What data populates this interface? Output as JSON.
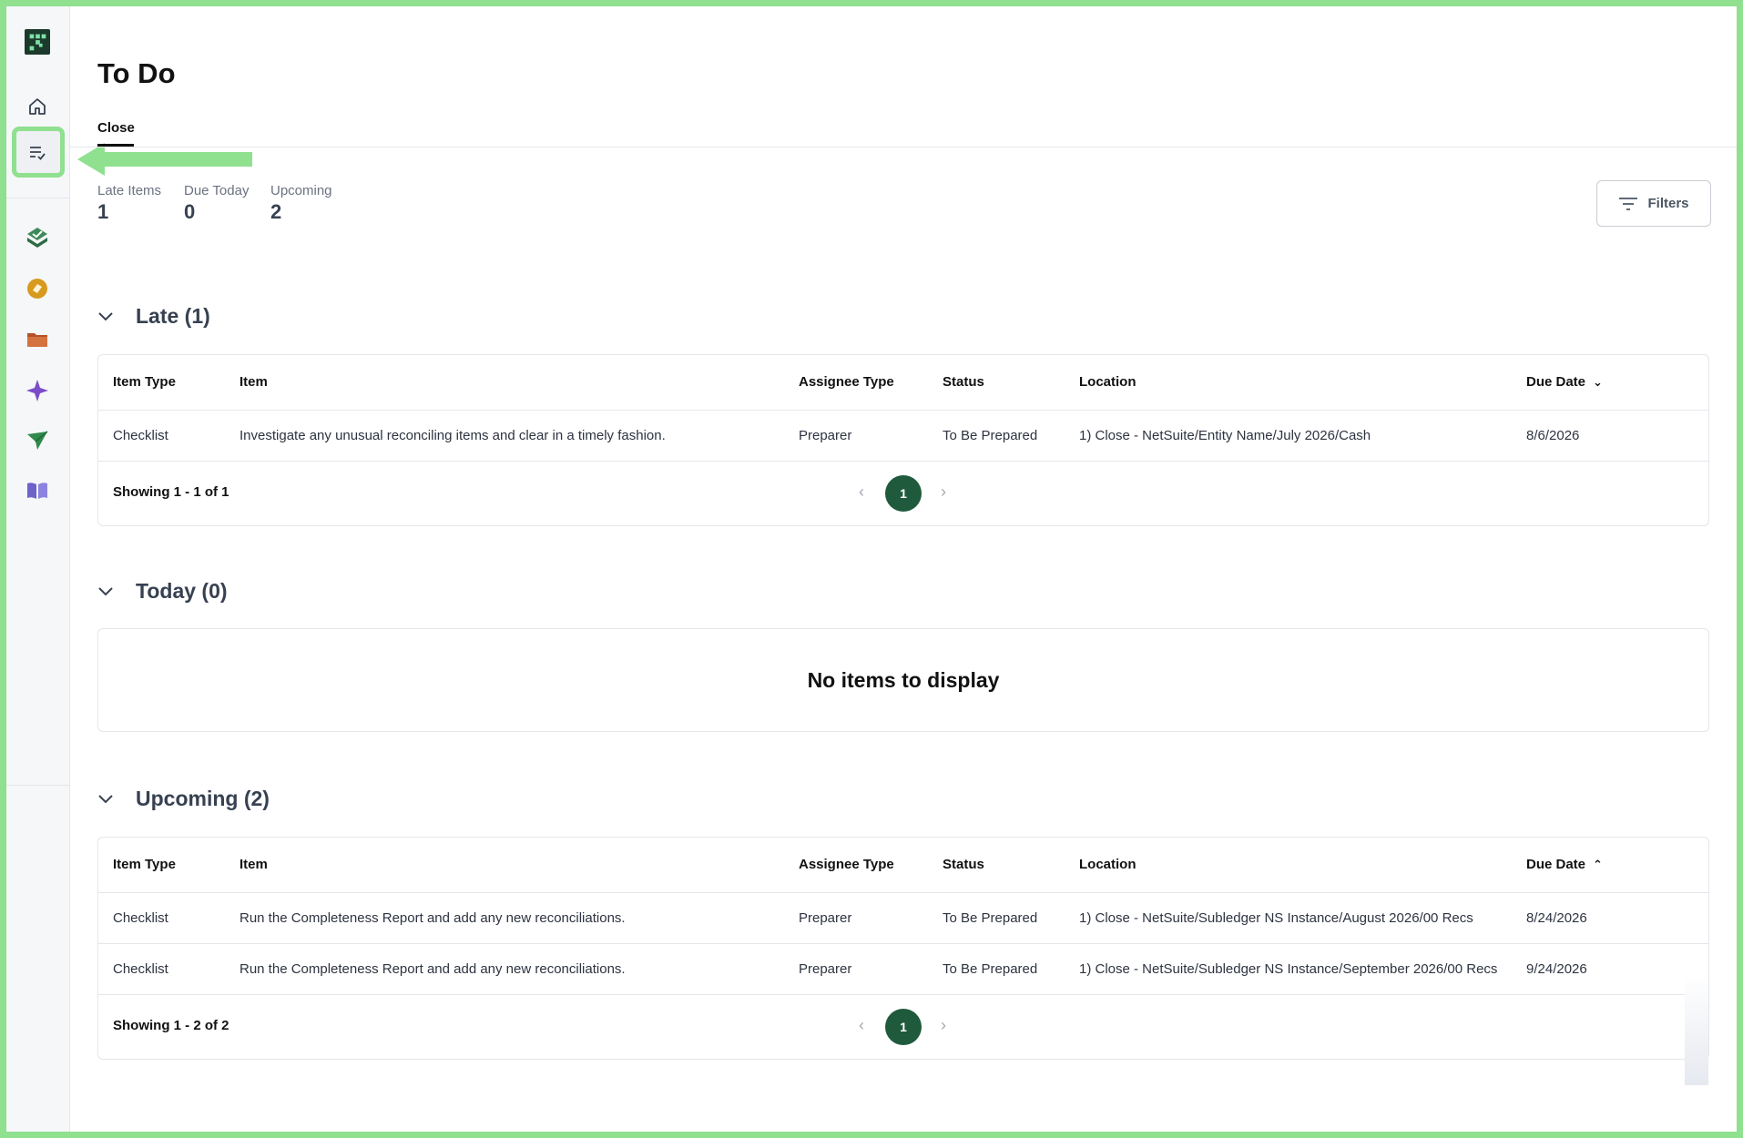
{
  "page": {
    "title": "To Do"
  },
  "tabs": [
    {
      "label": "Close",
      "active": true
    }
  ],
  "stats": [
    {
      "label": "Late Items",
      "value": "1"
    },
    {
      "label": "Due Today",
      "value": "0"
    },
    {
      "label": "Upcoming",
      "value": "2"
    }
  ],
  "filters": {
    "label": "Filters"
  },
  "columns": {
    "item_type": "Item Type",
    "item": "Item",
    "assignee_type": "Assignee Type",
    "status": "Status",
    "location": "Location",
    "due_date": "Due Date"
  },
  "sections": {
    "late": {
      "title": "Late (1)",
      "rows": [
        {
          "item_type": "Checklist",
          "item": "Investigate any unusual reconciling items and clear in a timely fashion.",
          "assignee_type": "Preparer",
          "status": "To Be Prepared",
          "location": "1) Close - NetSuite/Entity Name/July 2026/Cash",
          "due_date": "8/6/2026"
        }
      ],
      "showing": "Showing 1 - 1 of 1",
      "page": "1"
    },
    "today": {
      "title": "Today (0)",
      "empty": "No items to display"
    },
    "upcoming": {
      "title": "Upcoming (2)",
      "rows": [
        {
          "item_type": "Checklist",
          "item": "Run the Completeness Report and add any new reconciliations.",
          "assignee_type": "Preparer",
          "status": "To Be Prepared",
          "location": "1) Close - NetSuite/Subledger NS Instance/August 2026/00 Recs",
          "due_date": "8/24/2026"
        },
        {
          "item_type": "Checklist",
          "item": "Run the Completeness Report and add any new reconciliations.",
          "assignee_type": "Preparer",
          "status": "To Be Prepared",
          "location": "1) Close - NetSuite/Subledger NS Instance/September 2026/00 Recs",
          "due_date": "9/24/2026"
        }
      ],
      "showing": "Showing 1 - 2 of 2",
      "page": "1"
    }
  },
  "sidebar": {
    "icons": [
      "app-logo-icon",
      "home-icon",
      "todo-list-icon",
      "checkmark-layers-icon",
      "link-icon",
      "folder-icon",
      "sparkle-icon",
      "send-icon",
      "book-icon"
    ]
  },
  "colors": {
    "accent": "#1f5a3c",
    "highlight": "#8fe08f"
  }
}
